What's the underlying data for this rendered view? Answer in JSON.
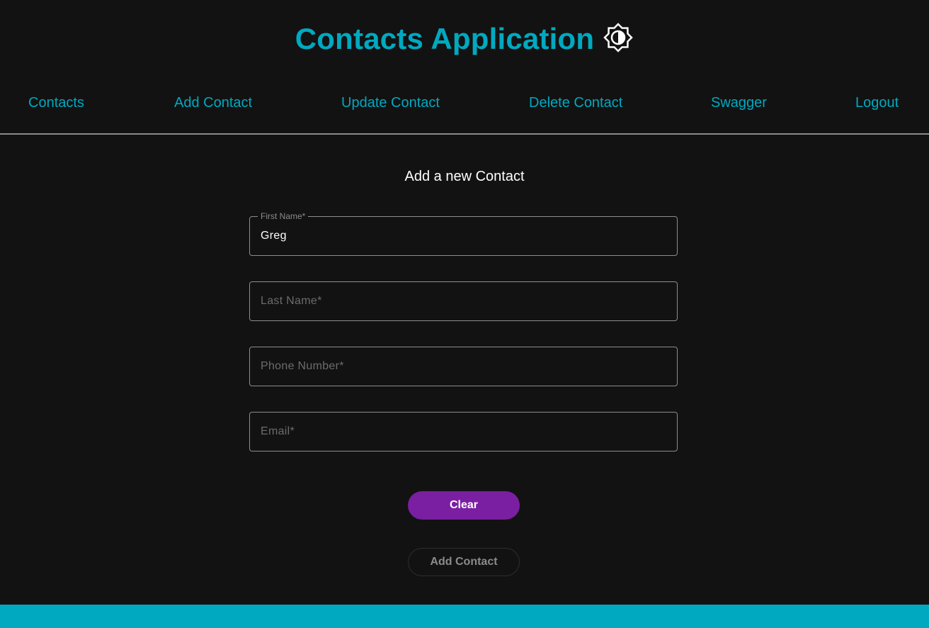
{
  "app": {
    "title": "Contacts Application",
    "theme_toggle_icon": "brightness-contrast-icon"
  },
  "nav": {
    "items": [
      {
        "label": "Contacts"
      },
      {
        "label": "Add Contact"
      },
      {
        "label": "Update Contact"
      },
      {
        "label": "Delete Contact"
      },
      {
        "label": "Swagger"
      },
      {
        "label": "Logout"
      }
    ]
  },
  "form": {
    "title": "Add a new Contact",
    "first_name": {
      "label": "First Name*",
      "value": "Greg"
    },
    "last_name": {
      "placeholder": "Last Name*",
      "value": ""
    },
    "phone": {
      "placeholder": "Phone Number*",
      "value": ""
    },
    "email": {
      "placeholder": "Email*",
      "value": ""
    },
    "clear_label": "Clear",
    "add_label": "Add Contact"
  },
  "colors": {
    "accent": "#00a9c0",
    "primary_button": "#7b1fa2",
    "background": "#121212"
  }
}
